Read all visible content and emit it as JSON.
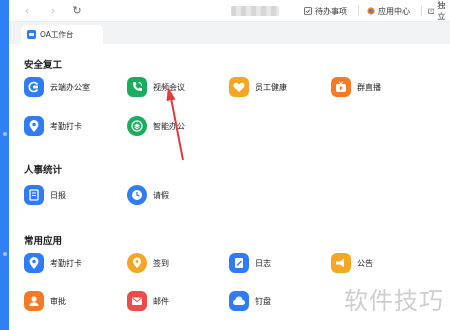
{
  "toolbar": {
    "back_icon": "‹",
    "forward_icon": "›",
    "refresh_icon": "↻",
    "items": [
      {
        "label": "待办事项",
        "icon": "todo-icon"
      },
      {
        "label": "应用中心",
        "icon": "app-center-icon"
      },
      {
        "label": "独立",
        "icon": "window-icon"
      }
    ]
  },
  "tab": {
    "label": "OA工作台",
    "icon": "oa-icon"
  },
  "sections": [
    {
      "title": "安全复工",
      "apps": [
        {
          "label": "云端办公室",
          "color": "#2f7cf6",
          "icon": "cloud-office-icon"
        },
        {
          "label": "视频会议",
          "color": "#1aad5e",
          "icon": "video-meeting-icon"
        },
        {
          "label": "员工健康",
          "color": "#f5a623",
          "icon": "heart-icon"
        },
        {
          "label": "群直播",
          "color": "#f57a23",
          "icon": "live-icon"
        },
        {
          "label": "考勤打卡",
          "color": "#2f7cf6",
          "icon": "location-icon"
        },
        {
          "label": "智能办公",
          "color": "#1aad5e",
          "icon": "smart-office-icon"
        }
      ]
    },
    {
      "title": "人事统计",
      "apps": [
        {
          "label": "日报",
          "color": "#2f7cf6",
          "icon": "daily-report-icon"
        },
        {
          "label": "请假",
          "color": "#2f7cf6",
          "icon": "clock-icon"
        }
      ]
    },
    {
      "title": "常用应用",
      "apps": [
        {
          "label": "考勤打卡",
          "color": "#2f7cf6",
          "icon": "location-icon"
        },
        {
          "label": "签到",
          "color": "#f5a623",
          "icon": "checkin-icon"
        },
        {
          "label": "日志",
          "color": "#2f7cf6",
          "icon": "log-icon"
        },
        {
          "label": "公告",
          "color": "#f5a623",
          "icon": "announcement-icon"
        },
        {
          "label": "审批",
          "color": "#f57a23",
          "icon": "approval-icon"
        },
        {
          "label": "邮件",
          "color": "#ef4b4b",
          "icon": "mail-icon"
        },
        {
          "label": "钉盘",
          "color": "#2f7cf6",
          "icon": "cloud-drive-icon"
        }
      ]
    }
  ],
  "watermark": "软件技巧",
  "colors": {
    "accent": "#2f80f5",
    "annotation_arrow": "#e23b3b"
  }
}
